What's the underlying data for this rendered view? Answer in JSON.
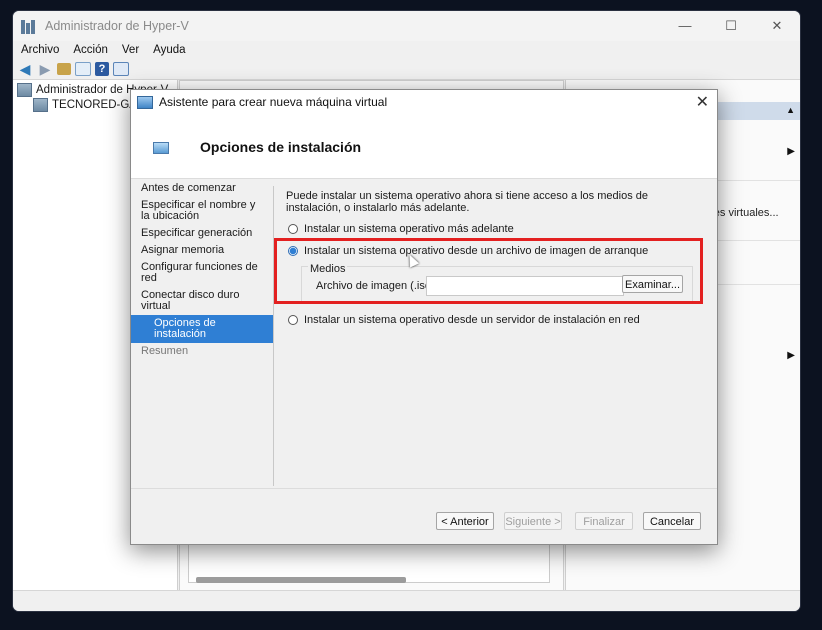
{
  "app": {
    "title": "Administrador de Hyper-V",
    "controls": {
      "minimize": "—",
      "maximize": "☐",
      "close": "✕"
    },
    "menu": [
      "Archivo",
      "Acción",
      "Ver",
      "Ayuda"
    ],
    "tree": {
      "root": "Administrador de Hyper-V",
      "server": "TECNORED-GAME"
    },
    "right_pane": {
      "item_text": "ores virtuales..."
    }
  },
  "dialog": {
    "title": "Asistente para crear nueva máquina virtual",
    "close": "✕",
    "header": "Opciones de instalación",
    "nav": [
      {
        "label": "Antes de comenzar"
      },
      {
        "label": "Especificar el nombre y la ubicación"
      },
      {
        "label": "Especificar generación"
      },
      {
        "label": "Asignar memoria"
      },
      {
        "label": "Configurar funciones de red"
      },
      {
        "label": "Conectar disco duro virtual"
      },
      {
        "label": "Opciones de instalación"
      },
      {
        "label": "Resumen"
      }
    ],
    "description": "Puede instalar un sistema operativo ahora si tiene acceso a los medios de instalación, o instalarlo más adelante.",
    "options": {
      "later": "Instalar un sistema operativo más adelante",
      "image": "Instalar un sistema operativo desde un archivo de imagen de arranque",
      "network": "Instalar un sistema operativo desde un servidor de instalación en red"
    },
    "selected_option": "image",
    "media": {
      "group_label": "Medios",
      "iso_label": "Archivo de imagen (.iso):",
      "iso_value": "",
      "browse": "Examinar..."
    },
    "buttons": {
      "back": "< Anterior",
      "next": "Siguiente >",
      "finish": "Finalizar",
      "cancel": "Cancelar"
    }
  },
  "colors": {
    "selection": "#2f7fd4",
    "highlight_box": "#e32020",
    "desktop": "#0c1220"
  }
}
